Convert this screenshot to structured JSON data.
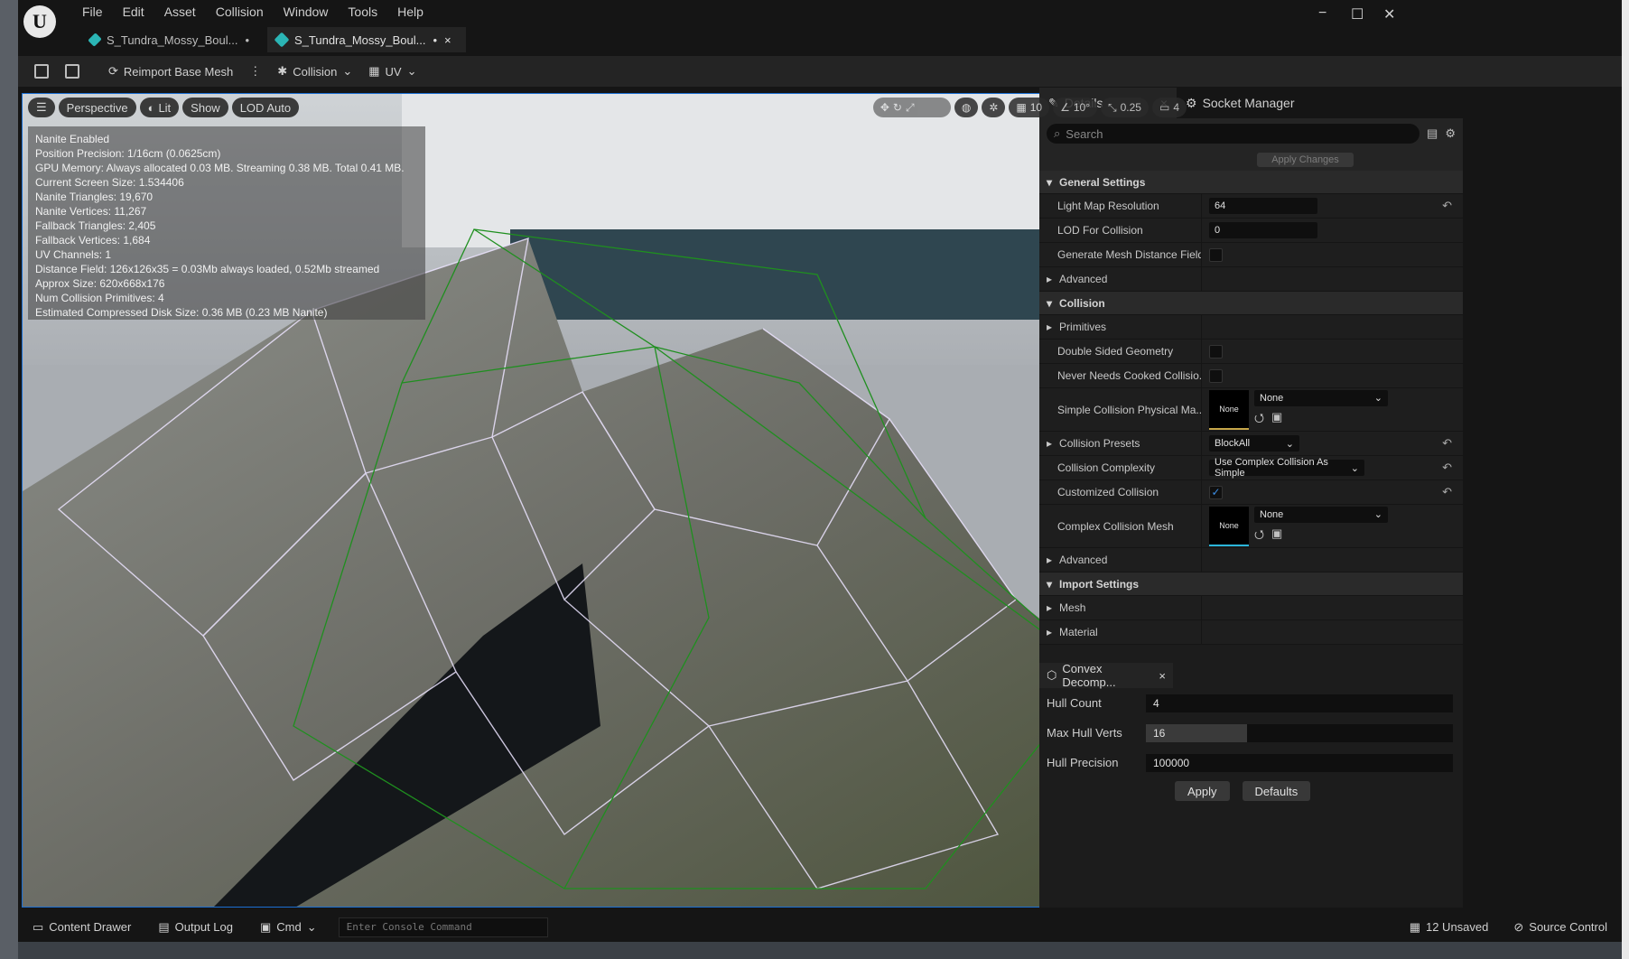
{
  "app": {
    "logo_letter": "U"
  },
  "menu": [
    "File",
    "Edit",
    "Asset",
    "Collision",
    "Window",
    "Tools",
    "Help"
  ],
  "tabs": [
    {
      "label": "S_Tundra_Mossy_Boul...",
      "dirty": "•"
    },
    {
      "label": "S_Tundra_Mossy_Boul...",
      "dirty": "•",
      "close": "×"
    }
  ],
  "window_controls": {
    "minimize": "−",
    "maximize": "☐",
    "close": "✕"
  },
  "toolbar": {
    "reimport": "Reimport Base Mesh",
    "collision": "Collision",
    "uv": "UV"
  },
  "viewport": {
    "perspective": "Perspective",
    "lit": "Lit",
    "show": "Show",
    "lod": "LOD Auto",
    "grid": "10",
    "angle": "10°",
    "scale": "0.25",
    "camera": "4"
  },
  "stats": [
    "Nanite Enabled",
    "Position Precision: 1/16cm (0.0625cm)",
    "GPU Memory: Always allocated 0.03 MB. Streaming 0.38 MB. Total 0.41 MB.",
    "Current Screen Size: 1.534406",
    "Nanite Triangles: 19,670",
    "Nanite Vertices: 11,267",
    "Fallback Triangles: 2,405",
    "Fallback Vertices: 1,684",
    "UV Channels: 1",
    "Distance Field: 126x126x35 = 0.03Mb always loaded, 0.52Mb streamed",
    "Approx Size: 620x668x176",
    "Num Collision Primitives: 4",
    "Estimated Compressed Disk Size: 0.36 MB (0.23 MB Nanite)"
  ],
  "details": {
    "tab": "Details",
    "socket_tab": "Socket Manager",
    "search_placeholder": "Search",
    "apply_changes": "Apply Changes",
    "general_settings": "General Settings",
    "light_map_label": "Light Map Resolution",
    "light_map_value": "64",
    "lod_collision_label": "LOD For Collision",
    "lod_collision_value": "0",
    "gen_mesh_df": "Generate Mesh Distance Field",
    "advanced": "Advanced",
    "collision": "Collision",
    "primitives": "Primitives",
    "double_sided": "Double Sided Geometry",
    "never_cooked": "Never Needs Cooked Collisio...",
    "simple_phys": "Simple Collision Physical Ma...",
    "none": "None",
    "collision_presets": "Collision Presets",
    "presets_value": "BlockAll",
    "collision_complexity": "Collision Complexity",
    "complexity_value": "Use Complex Collision As Simple",
    "customized": "Customized Collision",
    "complex_mesh": "Complex Collision Mesh",
    "advanced2": "Advanced",
    "import_settings": "Import Settings",
    "mesh": "Mesh",
    "material": "Material"
  },
  "convex": {
    "tab": "Convex Decomp...",
    "hull_count_label": "Hull Count",
    "hull_count": "4",
    "max_verts_label": "Max Hull Verts",
    "max_verts": "16",
    "max_verts_fill": 0.33,
    "precision_label": "Hull Precision",
    "precision": "100000",
    "apply": "Apply",
    "defaults": "Defaults"
  },
  "statusbar": {
    "content_drawer": "Content Drawer",
    "output_log": "Output Log",
    "cmd": "Cmd",
    "console_placeholder": "Enter Console Command",
    "unsaved": "12 Unsaved",
    "source_control": "Source Control"
  },
  "colors": {
    "accent": "#1b6fd3",
    "collision_wire": "#1f8f1f",
    "mesh_wire": "#e8e0ff"
  }
}
